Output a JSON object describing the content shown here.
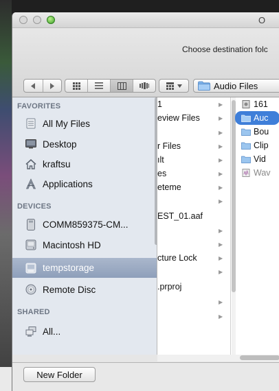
{
  "window": {
    "title": "O"
  },
  "dialog": {
    "prompt": "Choose destination folc"
  },
  "toolbar": {
    "nav": {
      "back_icon": "chevron-left-icon",
      "forward_icon": "chevron-right-icon"
    },
    "views": [
      {
        "name": "icon-view",
        "icon": "grid-icon"
      },
      {
        "name": "list-view",
        "icon": "list-icon"
      },
      {
        "name": "column-view",
        "icon": "columns-icon",
        "selected": true
      },
      {
        "name": "coverflow-view",
        "icon": "coverflow-icon"
      }
    ],
    "path_popup": {
      "label": "Audio Files"
    }
  },
  "sidebar": {
    "sections": {
      "favorites": "FAVORITES",
      "devices": "DEVICES",
      "shared": "SHARED"
    },
    "favorites": [
      {
        "label": "All My Files",
        "icon": "all-files-icon"
      },
      {
        "label": "Desktop",
        "icon": "desktop-icon"
      },
      {
        "label": "kraftsu",
        "icon": "home-icon"
      },
      {
        "label": "Applications",
        "icon": "applications-icon"
      }
    ],
    "devices": [
      {
        "label": "COMM859375-CM...",
        "icon": "drive-icon"
      },
      {
        "label": "Macintosh HD",
        "icon": "hard-disk-icon"
      },
      {
        "label": "tempstorage",
        "icon": "external-drive-icon",
        "selected": true
      },
      {
        "label": "Remote Disc",
        "icon": "disc-icon"
      }
    ],
    "shared": [
      {
        "label": "All...",
        "icon": "network-icon"
      }
    ]
  },
  "columns": {
    "col1": [
      {
        "label": "1",
        "arrow": "▶"
      },
      {
        "label": "eview Files",
        "arrow": "▶"
      },
      {
        "label": "",
        "arrow": "▶"
      },
      {
        "label": "r Files",
        "arrow": "▶"
      },
      {
        "label": "ılt",
        "arrow": "▶"
      },
      {
        "label": "es",
        "arrow": "▶"
      },
      {
        "label": "eteme",
        "arrow": "▶"
      },
      {
        "label": "",
        "arrow": "▶"
      },
      {
        "label": "EST_01.aaf",
        "arrow": ""
      },
      {
        "label": "",
        "arrow": "▶"
      },
      {
        "label": "",
        "arrow": "▶"
      },
      {
        "label": "cture Lock",
        "arrow": "▶"
      },
      {
        "label": "",
        "arrow": "▶"
      },
      {
        "label": ".prproj",
        "arrow": ""
      },
      {
        "label": "",
        "arrow": "▶"
      },
      {
        "label": "",
        "arrow": "▶"
      }
    ],
    "col2": [
      {
        "label": "161",
        "icon": "file-icon"
      },
      {
        "label": "Auc",
        "icon": "folder-icon",
        "selected": true
      },
      {
        "label": "Bou",
        "icon": "folder-icon"
      },
      {
        "label": "Clip",
        "icon": "folder-icon"
      },
      {
        "label": "Vid",
        "icon": "folder-icon"
      },
      {
        "label": "Wav",
        "icon": "audio-file-icon"
      }
    ]
  },
  "footer": {
    "new_folder_label": "New Folder"
  },
  "colors": {
    "selection_blue": "#3f7fd9",
    "sidebar_bg": "#e3e8ef",
    "sidebar_header": "#6d7684",
    "folder_blue": "#7fb3ea"
  }
}
